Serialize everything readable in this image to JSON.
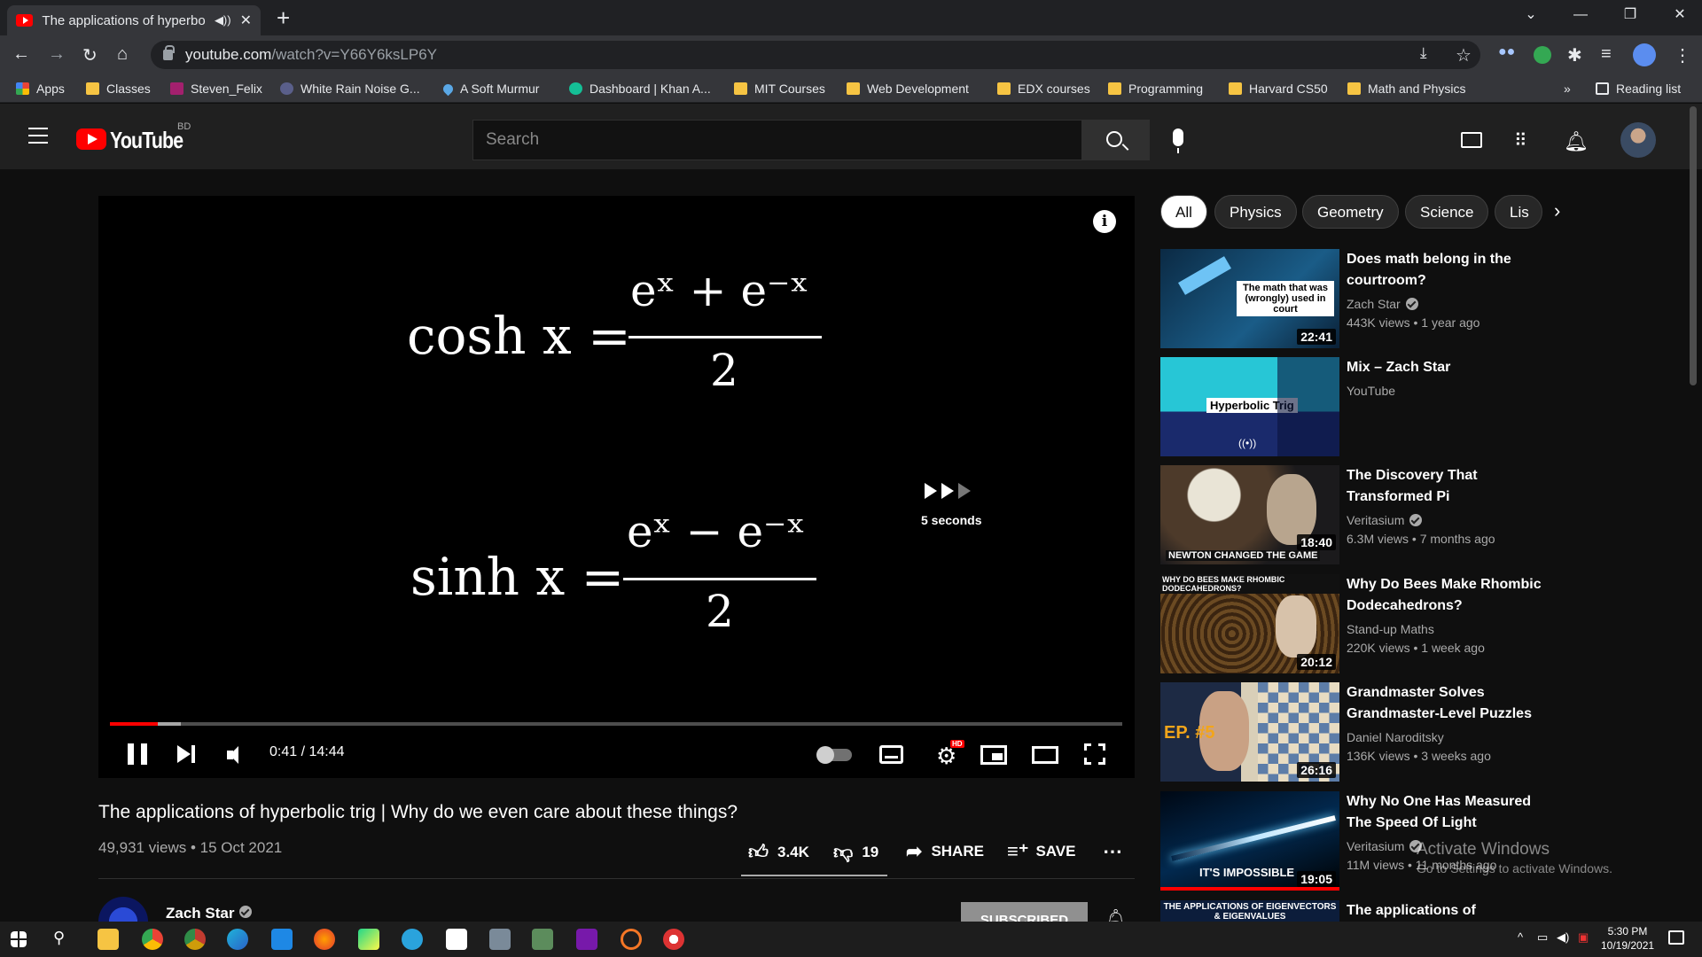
{
  "browser": {
    "tab_title": "The applications of hyperbolic",
    "url_host": "youtube.com",
    "url_path": "/watch?v=Y66Y6ksLP6Y",
    "bookmarks": [
      {
        "label": "Apps",
        "icon": "apps-grid-icon"
      },
      {
        "label": "Classes",
        "icon": "classroom-icon"
      },
      {
        "label": "Steven_Felix",
        "icon": "uva-icon"
      },
      {
        "label": "White Rain Noise G...",
        "icon": "noise-icon"
      },
      {
        "label": "A Soft Murmur",
        "icon": "drop-icon"
      },
      {
        "label": "Dashboard | Khan A...",
        "icon": "khan-icon"
      },
      {
        "label": "MIT Courses",
        "icon": "folder-icon"
      },
      {
        "label": "Web Development",
        "icon": "folder-icon"
      },
      {
        "label": "EDX courses",
        "icon": "folder-icon"
      },
      {
        "label": "Programming",
        "icon": "folder-icon"
      },
      {
        "label": "Harvard CS50",
        "icon": "folder-icon"
      },
      {
        "label": "Math and Physics",
        "icon": "folder-icon"
      }
    ],
    "more_bookmarks": "»",
    "reading_list": "Reading list"
  },
  "youtube": {
    "logo_text": "YouTube",
    "country_code": "BD",
    "search_placeholder": "Search"
  },
  "player": {
    "formula_cosh_lhs": "cosh x =",
    "formula_cosh_num": "eˣ + e⁻ˣ",
    "formula_sinh_lhs": "sinh x =",
    "formula_sinh_num": "eˣ − e⁻ˣ",
    "formula_den": "2",
    "skip_text": "5 seconds",
    "time": "0:41 / 14:44",
    "progress_played_fraction": 0.047,
    "quality_badge": "HD"
  },
  "video": {
    "title": "The applications of hyperbolic trig | Why do we even care about these things?",
    "meta": "49,931 views • 15 Oct 2021",
    "likes": "3.4K",
    "dislikes": "19",
    "share": "SHARE",
    "save": "SAVE",
    "channel": "Zach Star",
    "subscribe": "SUBSCRIBED"
  },
  "chips": [
    "All",
    "Physics",
    "Geometry",
    "Science",
    "Lis"
  ],
  "recommendations": [
    {
      "title": "Does math belong in the courtroom?",
      "channel": "Zach Star",
      "verified": true,
      "views": "443K views • 1 year ago",
      "duration": "22:41",
      "thumb_text": "The math that was (wrongly) used in court"
    },
    {
      "title": "Mix – Zach Star",
      "channel": "YouTube",
      "verified": false,
      "views": "",
      "duration": "",
      "thumb_text": "Hyperbolic Trig"
    },
    {
      "title": "The Discovery That Transformed Pi",
      "channel": "Veritasium",
      "verified": true,
      "views": "6.3M views • 7 months ago",
      "duration": "18:40",
      "thumb_text": "NEWTON CHANGED THE GAME"
    },
    {
      "title": "Why Do Bees Make Rhombic Dodecahedrons?",
      "channel": "Stand-up Maths",
      "verified": false,
      "views": "220K views • 1 week ago",
      "duration": "20:12",
      "thumb_text": "WHY DO BEES MAKE RHOMBIC DODECAHEDRONS?"
    },
    {
      "title": "Grandmaster Solves Grandmaster-Level Puzzles",
      "channel": "Daniel Naroditsky",
      "verified": false,
      "views": "136K views • 3 weeks ago",
      "duration": "26:16",
      "thumb_text": "EP. #5"
    },
    {
      "title": "Why No One Has Measured The Speed Of Light",
      "channel": "Veritasium",
      "verified": true,
      "views": "11M views • 11 months ago",
      "duration": "19:05",
      "thumb_text": "IT'S IMPOSSIBLE"
    },
    {
      "title": "The applications of",
      "channel": "",
      "verified": false,
      "views": "",
      "duration": "",
      "thumb_text": "THE APPLICATIONS OF EIGENVECTORS & EIGENVALUES"
    }
  ],
  "watermark": {
    "line1": "Activate Windows",
    "line2": "Go to Settings to activate Windows."
  },
  "taskbar": {
    "time": "5:30 PM",
    "date": "10/19/2021"
  }
}
